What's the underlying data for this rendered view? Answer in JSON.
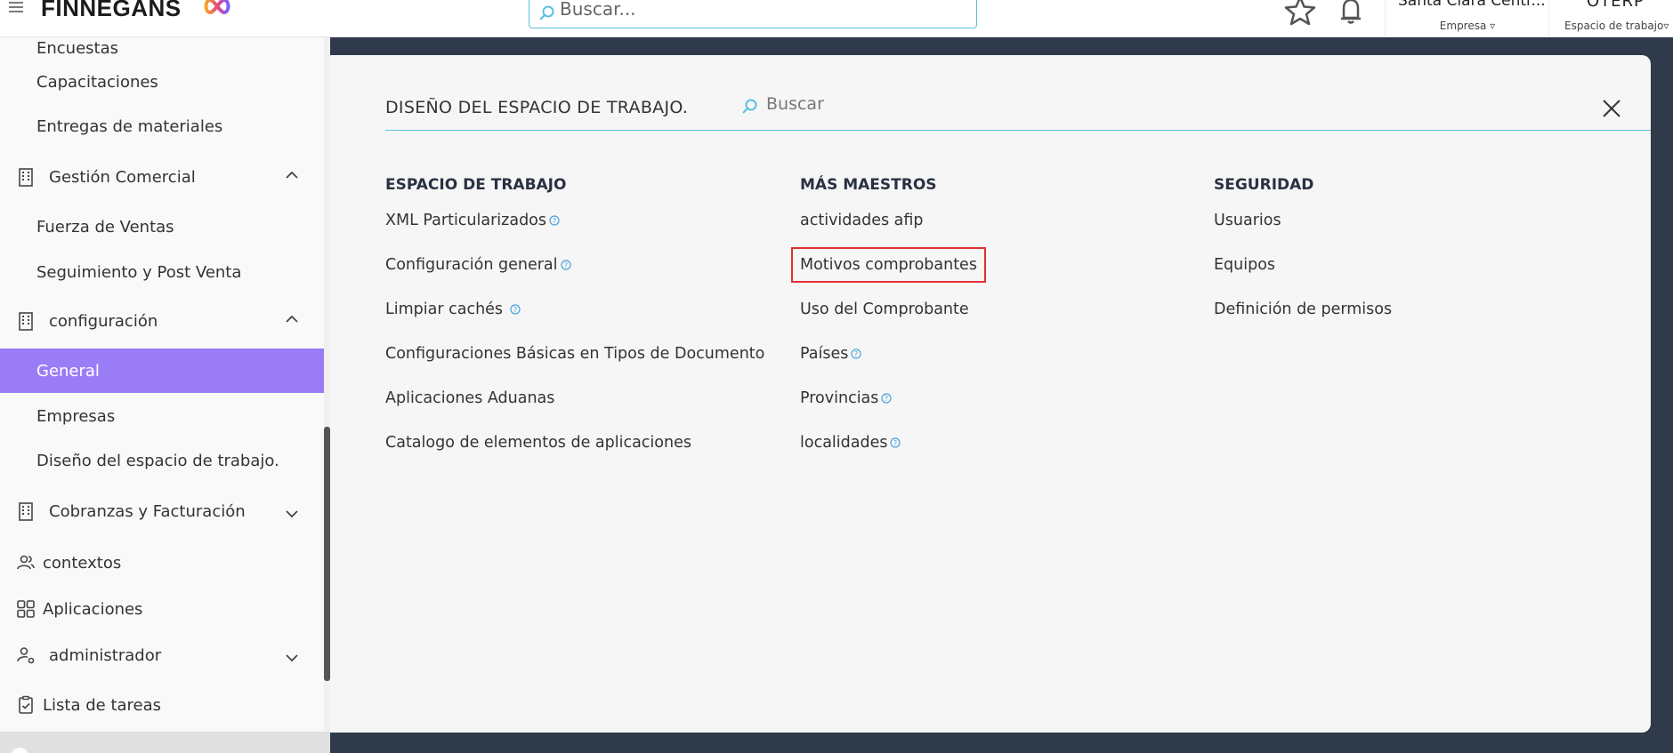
{
  "topbar": {
    "brand": "FINNEGANS",
    "search_placeholder": "Buscar...",
    "company_name": "Santa Clara Centr...",
    "company_label": "Empresa",
    "workspace_name": "OTERP",
    "workspace_label": "Espacio de trabajo"
  },
  "sidebar": {
    "items": [
      {
        "label": "Encuestas"
      },
      {
        "label": "Capacitaciones"
      },
      {
        "label": "Entregas de materiales"
      },
      {
        "label": "Gestión Comercial"
      },
      {
        "label": "Fuerza de Ventas"
      },
      {
        "label": "Seguimiento y Post Venta"
      },
      {
        "label": "configuración"
      },
      {
        "label": "General"
      },
      {
        "label": "Empresas"
      },
      {
        "label": "Diseño del espacio de trabajo."
      },
      {
        "label": "Cobranzas y Facturación"
      },
      {
        "label": "contextos"
      },
      {
        "label": "Aplicaciones"
      },
      {
        "label": "administrador"
      },
      {
        "label": "Lista de tareas"
      }
    ]
  },
  "panel": {
    "title": "DISEÑO DEL ESPACIO DE TRABAJO.",
    "search_placeholder": "Buscar",
    "columns": [
      {
        "heading": "ESPACIO DE TRABAJO",
        "links": [
          {
            "label": "XML Particularizados"
          },
          {
            "label": "Configuración general"
          },
          {
            "label": "Limpiar cachés"
          },
          {
            "label": "Configuraciones Básicas en Tipos de Documento"
          },
          {
            "label": "Aplicaciones Aduanas"
          },
          {
            "label": "Catalogo de elementos de aplicaciones"
          }
        ]
      },
      {
        "heading": "MÁS MAESTROS",
        "links": [
          {
            "label": "actividades afip"
          },
          {
            "label": "Motivos comprobantes"
          },
          {
            "label": "Uso del Comprobante"
          },
          {
            "label": "Países"
          },
          {
            "label": "Provincias"
          },
          {
            "label": "localidades"
          }
        ]
      },
      {
        "heading": "SEGURIDAD",
        "links": [
          {
            "label": "Usuarios"
          },
          {
            "label": "Equipos"
          },
          {
            "label": "Definición de permisos"
          }
        ]
      }
    ]
  },
  "colors": {
    "accent": "#5bc0de",
    "active_item": "#9b7cf7",
    "backdrop": "#2f3a4a",
    "highlight_box": "#e03030"
  }
}
